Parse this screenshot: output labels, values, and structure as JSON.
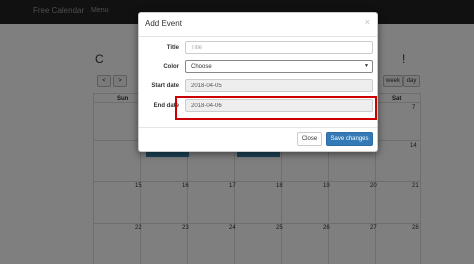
{
  "navbar": {
    "brand": "Free Calendar",
    "menu": "Menu"
  },
  "page": {
    "title_left": "C",
    "title_right": "!"
  },
  "calendar_controls": {
    "prev": "<",
    "next": ">",
    "week": "week",
    "day": "day"
  },
  "calendar": {
    "day_names": [
      "Sun",
      "",
      "",
      "",
      "",
      "",
      "Sat"
    ],
    "row1_dates": [
      "",
      "",
      "",
      "",
      "",
      "",
      "7"
    ],
    "row2_dates": [
      "",
      "",
      "",
      "",
      "",
      "",
      "14"
    ],
    "row3_dates": [
      "15",
      "16",
      "17",
      "18",
      "19",
      "20",
      "21"
    ],
    "row4_dates": [
      "22",
      "23",
      "24",
      "25",
      "26",
      "27",
      "28"
    ],
    "event_color": "#3a87ad"
  },
  "modal": {
    "title": "Add Event",
    "close_glyph": "×",
    "fields": {
      "title_label": "Title",
      "title_placeholder": "Title",
      "color_label": "Color",
      "color_value": "Choose",
      "start_label": "Start date",
      "start_value": "2018-04-05",
      "end_label": "End date",
      "end_value": "2018-04-06"
    },
    "close_label": "Close",
    "save_label": "Save changes"
  },
  "colors": {
    "primary": "#337ab7",
    "highlight": "#cc0000",
    "navbar": "#222222"
  }
}
